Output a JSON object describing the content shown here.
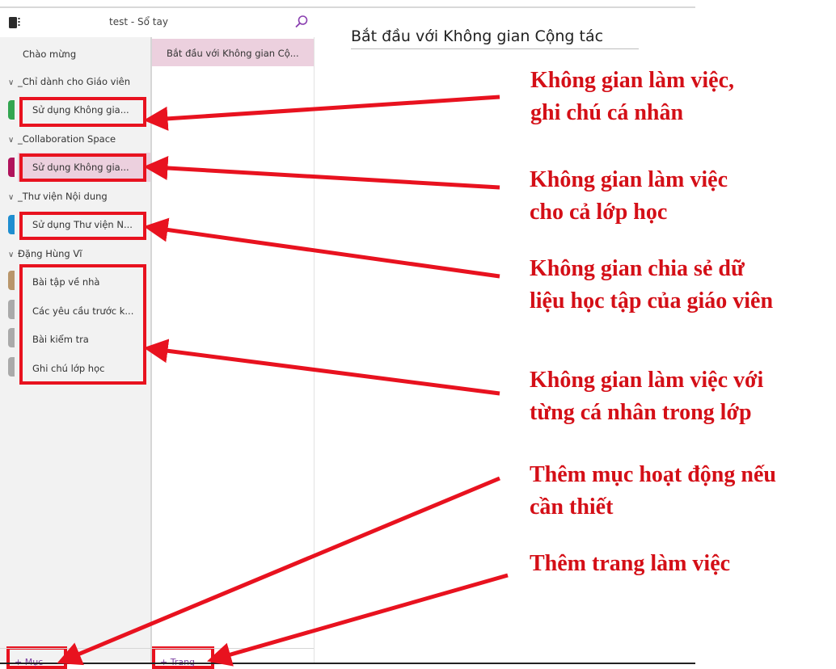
{
  "header": {
    "notebook_title": "test - Sổ tay"
  },
  "sections": {
    "welcome": "Chào mừng",
    "groups": [
      {
        "name": "_Chỉ dành cho Giáo viên",
        "items": [
          {
            "label": "Sử dụng Không gia...",
            "color": "#33a651"
          }
        ]
      },
      {
        "name": "_Collaboration Space",
        "items": [
          {
            "label": "Sử dụng Không gia...",
            "color": "#b0135c"
          }
        ]
      },
      {
        "name": "_Thư viện Nội dung",
        "items": [
          {
            "label": "Sử dụng Thư viện N...",
            "color": "#1f8ed0"
          }
        ]
      },
      {
        "name": "Đặng Hùng Vĩ",
        "items": [
          {
            "label": "Bài tập về nhà",
            "color": "#b9966b"
          },
          {
            "label": "Các yêu cầu trước k...",
            "color": "#aaaaaa"
          },
          {
            "label": "Bài kiểm tra",
            "color": "#aaaaaa"
          },
          {
            "label": "Ghi chú lớp học",
            "color": "#aaaaaa"
          }
        ]
      }
    ],
    "add_label": "+ Mục"
  },
  "pages": {
    "items": [
      "Bắt đầu với Không gian Cộ..."
    ],
    "add_label": "+ Trang"
  },
  "page": {
    "heading": "Bắt đầu với Không gian Cộng tác"
  },
  "annotations": {
    "a1": [
      "Không gian làm việc,",
      "ghi chú cá nhân"
    ],
    "a2": [
      "Không gian làm việc",
      "cho cả lớp học"
    ],
    "a3": [
      "Không gian chia sẻ dữ",
      "liệu học tập của giáo viên"
    ],
    "a4": [
      "Không gian làm việc với",
      "từng cá nhân trong lớp"
    ],
    "a5": [
      "Thêm mục hoạt động nếu",
      "cần thiết"
    ],
    "a6": [
      "Thêm trang làm việc"
    ]
  },
  "colors": {
    "accent": "#7a3ea0",
    "annotation": "#d40f17",
    "selection": "#ecd0de"
  }
}
